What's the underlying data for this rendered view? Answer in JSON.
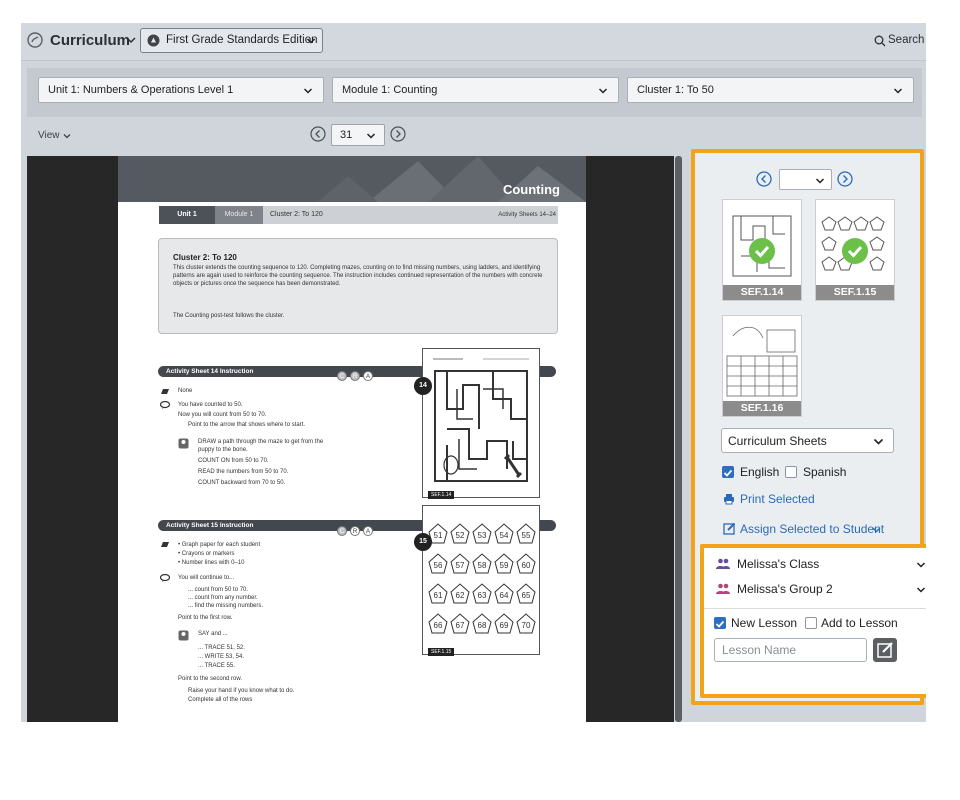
{
  "header": {
    "app_title": "Curriculum",
    "edition_label": "First Grade Standards Edition",
    "search_label": "Search"
  },
  "selectors": {
    "unit": "Unit 1: Numbers & Operations Level 1",
    "module": "Module 1: Counting",
    "cluster": "Cluster 1: To 50"
  },
  "toolbar": {
    "view_label": "View",
    "page_value": "31"
  },
  "document": {
    "banner_title": "Counting",
    "crumb_unit": "Unit 1",
    "crumb_module": "Module 1",
    "crumb_cluster": "Cluster 2: To 120",
    "crumb_sheets": "Activity Sheets 14–24",
    "cluster_title": "Cluster 2: To 120",
    "cluster_body": "This cluster extends the counting sequence to 120. Completing mazes, counting on to find missing numbers, using ladders, and identifying patterns are again used to reinforce the counting sequence. The instruction includes continued representation of the numbers with concrete objects or pictures once the sequence has been demonstrated.",
    "cluster_foot": "The Counting post-test follows the cluster.",
    "as14_title": "Activity Sheet 14 Instruction",
    "as14_materials": "None",
    "as14_lines": [
      "You have counted to 50.",
      "Now you will count from 50 to 70.",
      "Point to the arrow that shows where to start.",
      "DRAW a path through the maze to get from the",
      "puppy to the bone.",
      "COUNT ON from 50 to 70.",
      "READ the numbers from 50 to 70.",
      "COUNT backward from 70 to 50."
    ],
    "as15_title": "Activity Sheet 15 Instruction",
    "as15_materials": [
      "• Graph paper for each student",
      "• Crayons or markers",
      "• Number lines with 0–10"
    ],
    "as15_lines": [
      "You will continue to...",
      "... count from 50 to 70.",
      "... count from any number.",
      "... find the missing numbers.",
      "Point to the first row.",
      "SAY and ...",
      "... TRACE 51, 52.",
      "... WRITE 53, 54.",
      "... TRACE 55.",
      "Point to the second row.",
      "Raise your hand if you know what to do.",
      "Complete all of the rows"
    ],
    "cra_letters": [
      "C",
      "R",
      "A"
    ],
    "ws14_num": "14",
    "ws14_tag": "SEF.1.14",
    "ws15_num": "15",
    "ws15_tag": "SEF.1.15",
    "ws15_rows": [
      [
        "51",
        "52",
        "53",
        "54",
        "55"
      ],
      [
        "56",
        "57",
        "58",
        "59",
        "60"
      ],
      [
        "61",
        "62",
        "63",
        "64",
        "65"
      ],
      [
        "66",
        "67",
        "68",
        "69",
        "70"
      ]
    ]
  },
  "right_panel": {
    "page_select_value": "",
    "thumbnails": [
      {
        "label": "SEF.1.14",
        "selected": true
      },
      {
        "label": "SEF.1.15",
        "selected": true
      },
      {
        "label": "SEF.1.16",
        "selected": false
      }
    ],
    "sheet_type": "Curriculum Sheets",
    "english_label": "English",
    "english_checked": true,
    "spanish_label": "Spanish",
    "spanish_checked": false,
    "print_label": "Print Selected",
    "assign_label": "Assign Selected to Student"
  },
  "assign_panel": {
    "class_label": "Melissa's Class",
    "group_label": "Melissa's Group 2",
    "new_lesson_label": "New Lesson",
    "new_lesson_checked": true,
    "add_lesson_label": "Add to Lesson",
    "add_lesson_checked": false,
    "lesson_placeholder": "Lesson Name"
  },
  "colors": {
    "accent_orange": "#f2a31a",
    "link_blue": "#2a6bb8",
    "check_green": "#6cc04a",
    "group_purple": "#6a4c9c",
    "group_pink": "#b0457c"
  }
}
